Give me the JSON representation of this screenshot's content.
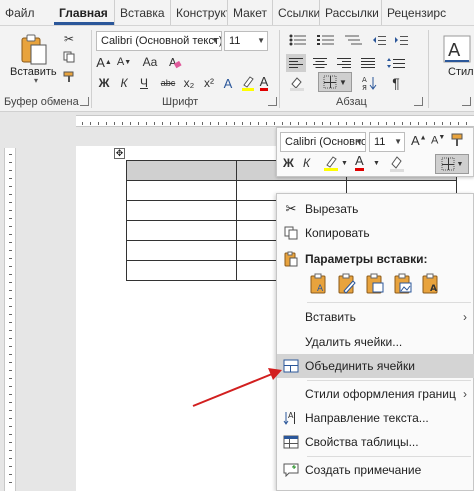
{
  "tabs": [
    {
      "label": "Файл"
    },
    {
      "label": "Главная",
      "active": true
    },
    {
      "label": "Вставка"
    },
    {
      "label": "Конструкт"
    },
    {
      "label": "Макет"
    },
    {
      "label": "Ссылки"
    },
    {
      "label": "Рассылки"
    },
    {
      "label": "Рецензирс"
    }
  ],
  "ribbon": {
    "paste_label": "Вставить",
    "clipboard_group": "Буфер обмена",
    "font_group": "Шрифт",
    "paragraph_group": "Абзац",
    "styles_label": "Стили",
    "font_name": "Calibri (Основной текст)",
    "font_size": "11",
    "bold": "Ж",
    "italic": "К",
    "underline": "Ч",
    "strike": "abc",
    "subscript": "x₂",
    "superscript": "x²",
    "grow_font": "A",
    "shrink_font": "A",
    "change_case": "Aa",
    "font_color_letter": "A",
    "pilcrow": "¶"
  },
  "mini_toolbar": {
    "font_name": "Calibri (Основной текст)",
    "font_size": "11",
    "grow_font": "A",
    "shrink_font": "A",
    "bold": "Ж",
    "italic": "К",
    "font_color_letter": "A"
  },
  "context_menu": {
    "cut": "Вырезать",
    "copy": "Копировать",
    "paste_options": "Параметры вставки:",
    "insert": "Вставить",
    "delete_cells": "Удалить ячейки...",
    "merge_cells": "Объединить ячейки",
    "border_styles": "Стили оформления границ",
    "text_direction": "Направление текста...",
    "table_properties": "Свойства таблицы...",
    "new_comment": "Создать примечание"
  },
  "colors": {
    "accent": "#2b579a",
    "highlight": "#ffff00",
    "font_color": "#e00000",
    "arrow": "#d21f1f",
    "paste_icon": "#e8a33d"
  }
}
